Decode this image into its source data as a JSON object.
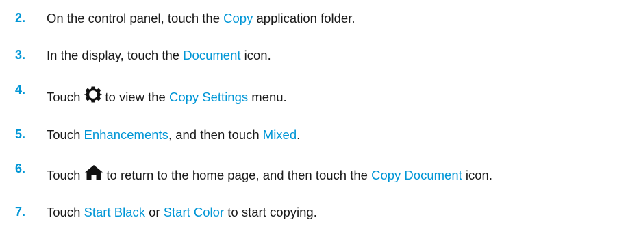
{
  "steps": [
    {
      "number": "2.",
      "parts": [
        "On the control panel, touch the ",
        "Copy",
        " application folder."
      ]
    },
    {
      "number": "3.",
      "parts": [
        "In the display, touch the ",
        "Document",
        " icon."
      ]
    },
    {
      "number": "4.",
      "icon": "gear-icon",
      "parts": [
        "Touch",
        "to view the ",
        "Copy Settings",
        " menu."
      ]
    },
    {
      "number": "5.",
      "parts": [
        "Touch ",
        "Enhancements",
        ", and then touch ",
        "Mixed",
        "."
      ]
    },
    {
      "number": "6.",
      "icon": "home-icon",
      "parts": [
        "Touch",
        "to return to the home page, and then touch the ",
        "Copy Document",
        " icon."
      ]
    },
    {
      "number": "7.",
      "parts": [
        "Touch ",
        "Start Black",
        " or ",
        "Start Color",
        " to start copying."
      ]
    }
  ],
  "colors": {
    "accent": "#0096d6",
    "text": "#1a1a1a"
  }
}
